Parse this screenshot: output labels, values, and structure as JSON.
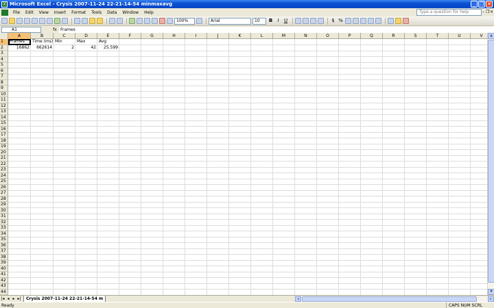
{
  "window": {
    "title": "Microsoft Excel - Crysis 2007-11-24 22-21-14-54 minmaxavg"
  },
  "menu": [
    "File",
    "Edit",
    "View",
    "Insert",
    "Format",
    "Tools",
    "Data",
    "Window",
    "Help"
  ],
  "help": {
    "placeholder": "Type a question for help"
  },
  "toolbar": {
    "zoom": "100%",
    "font": "Arial",
    "font_size": "10",
    "bold": "B",
    "italic": "I",
    "underline": "U",
    "currency": "$",
    "percent": "%"
  },
  "formula_bar": {
    "name_box": "A1",
    "fx": "fx",
    "content": "Frames"
  },
  "columns": [
    "A",
    "B",
    "C",
    "D",
    "E",
    "F",
    "G",
    "H",
    "I",
    "J",
    "K",
    "L",
    "M",
    "N",
    "O",
    "P",
    "Q",
    "R",
    "S",
    "T",
    "U",
    "V"
  ],
  "rows": [
    "1",
    "2",
    "3",
    "4",
    "5",
    "6",
    "7",
    "8",
    "9",
    "10",
    "11",
    "12",
    "13",
    "14",
    "15",
    "16",
    "17",
    "18",
    "19",
    "20",
    "21",
    "22",
    "23",
    "24",
    "25",
    "26",
    "27",
    "28",
    "29",
    "30",
    "31",
    "32",
    "33",
    "34",
    "35",
    "36",
    "37",
    "38",
    "39",
    "40",
    "41",
    "42",
    "43",
    "44"
  ],
  "cells": {
    "headers": [
      "Frames",
      "Time (ms)",
      "Min",
      "Max",
      "Avg"
    ],
    "values": [
      "16862",
      "662614",
      "2",
      "42",
      "25.599"
    ]
  },
  "sheet_tab": "Crysis 2007-11-24 22-21-14-54 m",
  "status": {
    "left": "Ready",
    "right": "CAPS NUM SCRL"
  }
}
